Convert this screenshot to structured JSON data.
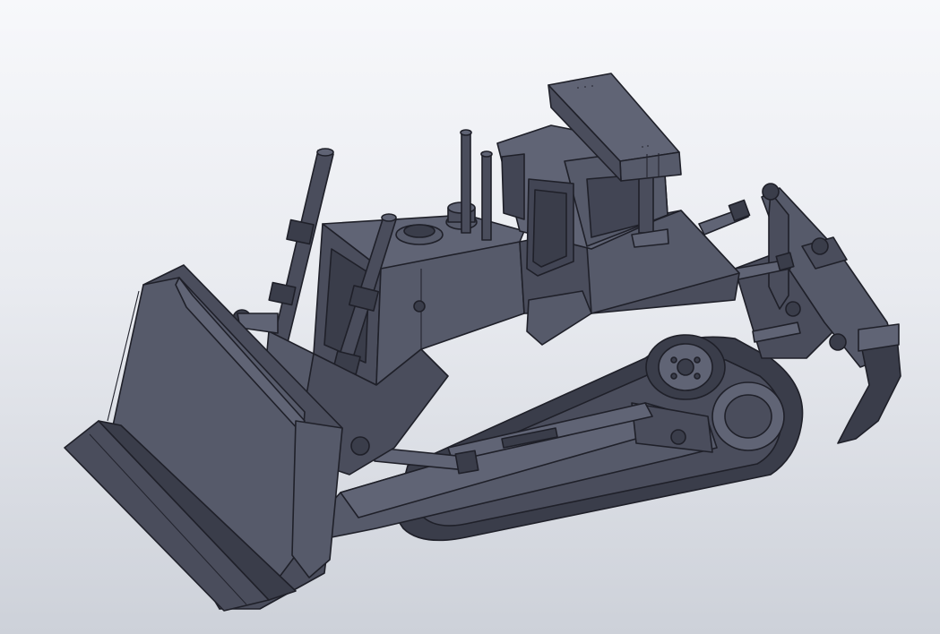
{
  "viewport": {
    "background_top": "#f7f8fb",
    "background_bottom": "#cdd1d9"
  },
  "model": {
    "subject": "bulldozer-3d-model",
    "shade": "#4a4d5c",
    "edge_color": "#1f2029"
  }
}
